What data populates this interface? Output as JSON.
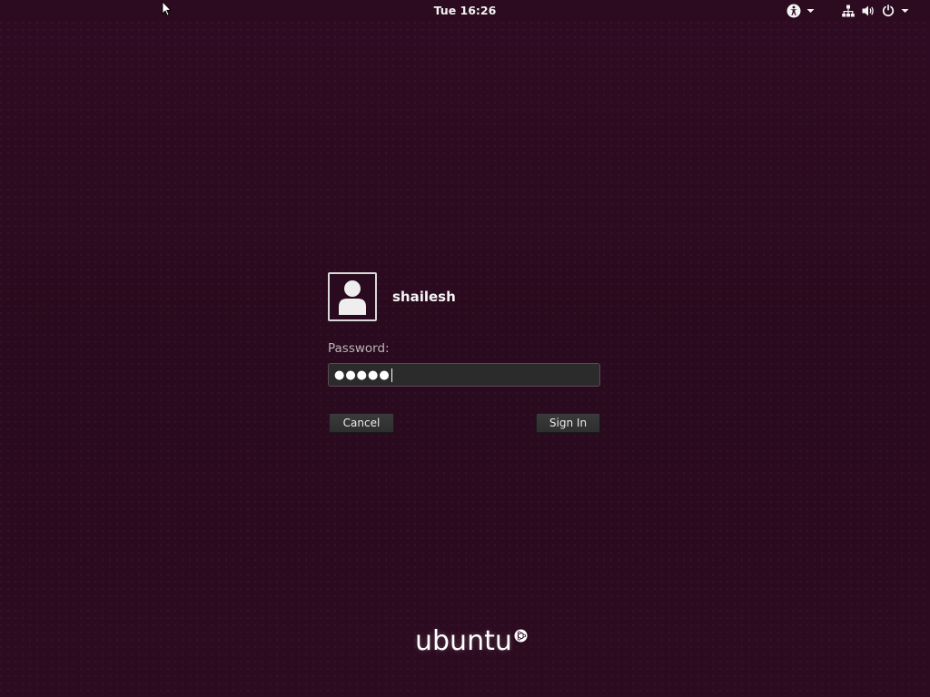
{
  "topbar": {
    "clock": "Tue 16:26",
    "icons": {
      "accessibility": "accessibility-icon",
      "network": "network-wired-icon",
      "volume": "volume-icon",
      "power": "power-icon",
      "dropdown": "chevron-down-icon"
    }
  },
  "login": {
    "username": "shailesh",
    "password_label": "Password:",
    "password_value": "●●●●●",
    "cancel_label": "Cancel",
    "signin_label": "Sign In"
  },
  "branding": {
    "logo_text": "ubuntu"
  },
  "colors": {
    "background": "#2c0a1f",
    "input_background": "#2b2b2b",
    "button_background": "#333333",
    "text": "#ffffff"
  }
}
